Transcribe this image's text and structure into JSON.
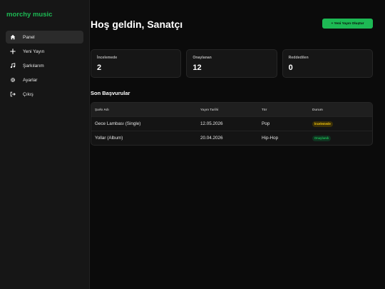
{
  "brand": "morchy music",
  "nav": [
    {
      "label": "Panel",
      "icon": "home-icon",
      "active": true
    },
    {
      "label": "Yeni Yayın",
      "icon": "plus-icon",
      "active": false
    },
    {
      "label": "Şarkılarım",
      "icon": "music-note-icon",
      "active": false
    },
    {
      "label": "Ayarlar",
      "icon": "gear-icon",
      "active": false
    },
    {
      "label": "Çıkış",
      "icon": "logout-icon",
      "active": false
    }
  ],
  "header": {
    "title": "Hoş geldin, Sanatçı",
    "create_button": "+ Yeni Yayın Oluştur"
  },
  "stats": [
    {
      "label": "İncelemede",
      "value": "2"
    },
    {
      "label": "Onaylanan",
      "value": "12"
    },
    {
      "label": "Reddedilen",
      "value": "0"
    }
  ],
  "recent": {
    "title": "Son Başvurular",
    "columns": [
      "Şarkı Adı",
      "Yayın Tarihi",
      "Tür",
      "Durum"
    ],
    "rows": [
      {
        "name": "Gece Lambası (Single)",
        "date": "12.05.2026",
        "genre": "Pop",
        "status": "İncelemede",
        "status_type": "pending"
      },
      {
        "name": "Yollar (Album)",
        "date": "20.04.2026",
        "genre": "Hip-Hop",
        "status": "Onaylandı",
        "status_type": "approved"
      }
    ]
  },
  "colors": {
    "accent": "#1db954",
    "background": "#0b0b0b",
    "sidebar": "#161616",
    "pending": "#f1c40f"
  }
}
